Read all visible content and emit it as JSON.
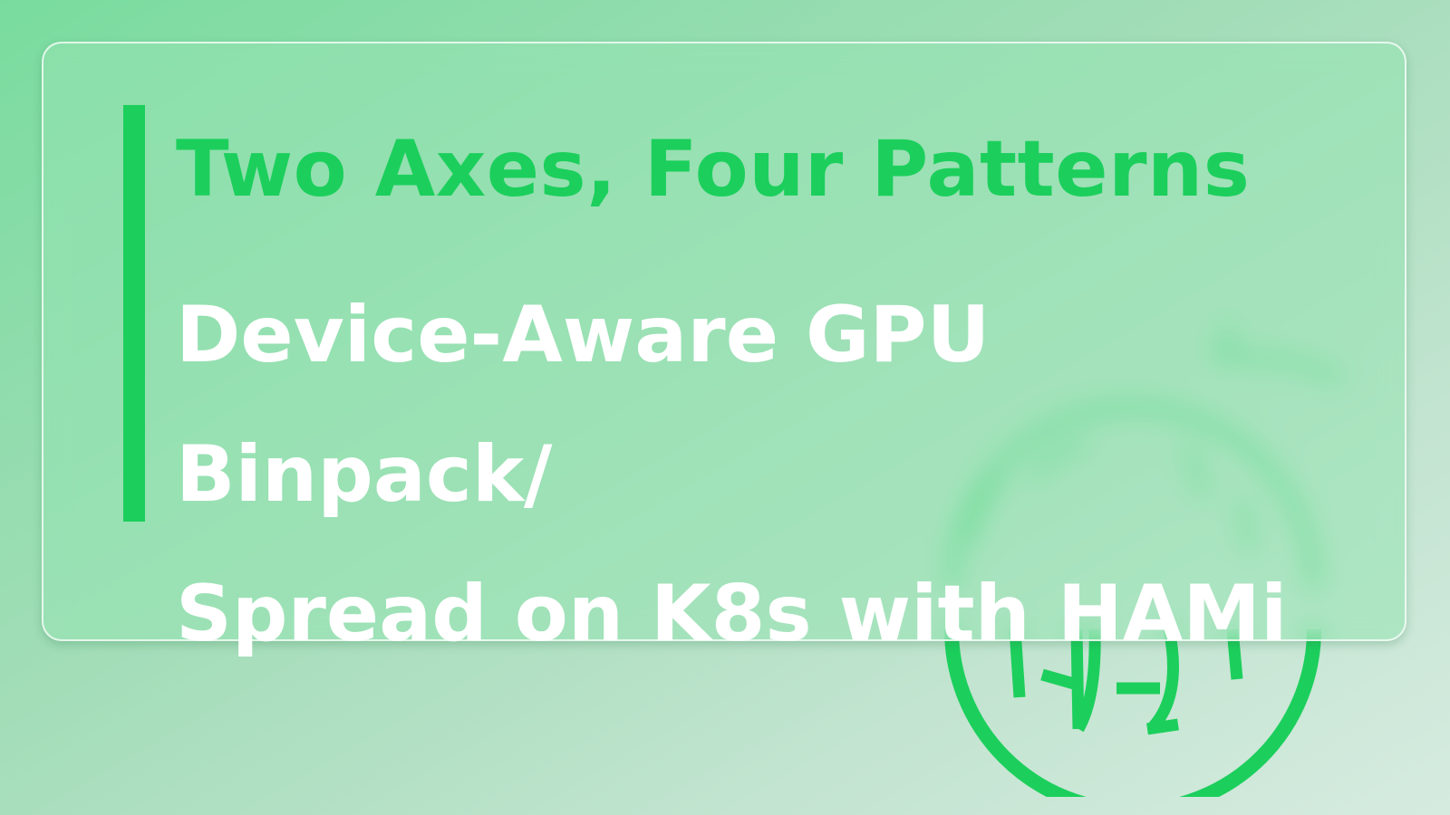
{
  "header": {
    "kicker": "Two Axes, Four Patterns",
    "title": "Device-Aware GPU Binpack/\nSpread on K8s with HAMi"
  },
  "logo": {
    "icon": "hami-logo-icon",
    "color": "#1ccf5c"
  },
  "colors": {
    "accent": "#1ccf5c",
    "title": "#ffffff",
    "background_start": "#79dc9e",
    "background_end": "#d6ebe0"
  }
}
